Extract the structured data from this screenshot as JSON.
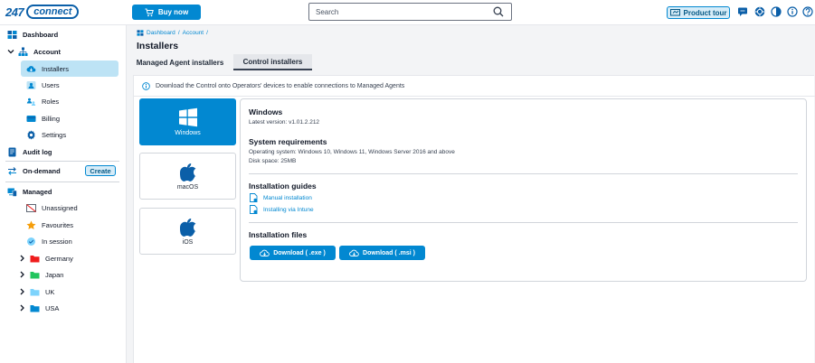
{
  "app": {
    "logo_number": "247",
    "logo_word": "connect"
  },
  "topbar": {
    "buy_label": "Buy now",
    "search_placeholder": "Search",
    "tour_label": "Product tour",
    "icons": [
      "chat-icon",
      "help-circle-icon",
      "contrast-icon",
      "info-icon",
      "question-icon"
    ]
  },
  "sidebar": {
    "dashboard": "Dashboard",
    "account": "Account",
    "installers": "Installers",
    "users": "Users",
    "roles": "Roles",
    "billing": "Billing",
    "settings": "Settings",
    "audit_log": "Audit log",
    "on_demand": "On-demand",
    "create_label": "Create",
    "managed": "Managed",
    "unassigned": "Unassigned",
    "favourites": "Favourites",
    "in_session": "In session",
    "groups": [
      {
        "label": "Germany",
        "color": "#ef1c1c"
      },
      {
        "label": "Japan",
        "color": "#22c55e"
      },
      {
        "label": "UK",
        "color": "#7dd3fc"
      },
      {
        "label": "USA",
        "color": "#0288d1"
      }
    ]
  },
  "breadcrumb": {
    "item1": "Dashboard",
    "item2": "Account",
    "sep": "/"
  },
  "page": {
    "title": "Installers",
    "tabs": [
      "Managed Agent installers",
      "Control installers"
    ],
    "info_text": "Download the Control onto Operators' devices to enable connections to Managed Agents"
  },
  "os_cards": [
    "Windows",
    "macOS",
    "iOS"
  ],
  "detail": {
    "os_name": "Windows",
    "latest_version": "Latest version: v1.01.2.212",
    "req_title": "System requirements",
    "req_os": "Operating system: Windows 10, Windows 11, Windows Server 2016 and above",
    "req_disk": "Disk space: 25MB",
    "guides_title": "Installation guides",
    "guide1": "Manual installation",
    "guide2": "Installing via Intune",
    "files_title": "Installation files",
    "dl_exe": "Download ( .exe )",
    "dl_msi": "Download ( .msi )"
  },
  "colors": {
    "accent": "#0288d1",
    "active_nav": "#bde3f5"
  }
}
